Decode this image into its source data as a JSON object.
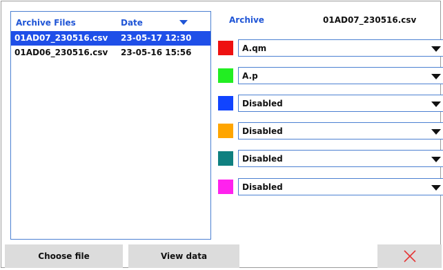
{
  "file_list": {
    "header": {
      "name_label": "Archive Files",
      "date_label": "Date",
      "sort_icon": "sort-descending-triangle"
    },
    "rows": [
      {
        "name": "01AD07_230516.csv",
        "date": "23-05-17 12:30",
        "selected": true
      },
      {
        "name": "01AD06_230516.csv",
        "date": "23-05-16 15:56",
        "selected": false
      }
    ]
  },
  "archive": {
    "label": "Archive",
    "value": "01AD07_230516.csv"
  },
  "channels": [
    {
      "color": "#ee1111",
      "value": "A.qm"
    },
    {
      "color": "#22ee22",
      "value": "A.p"
    },
    {
      "color": "#1144ff",
      "value": "Disabled"
    },
    {
      "color": "#ffa500",
      "value": "Disabled"
    },
    {
      "color": "#0f8080",
      "value": "Disabled"
    },
    {
      "color": "#ff22ee",
      "value": "Disabled"
    }
  ],
  "buttons": {
    "choose_file": "Choose file",
    "view_data": "View data",
    "close_icon": "close-x-icon",
    "close_color": "#e53535"
  },
  "colors": {
    "accent": "#1f55d6",
    "selection": "#1f4fe8",
    "button_bg": "#dcdcdc"
  }
}
